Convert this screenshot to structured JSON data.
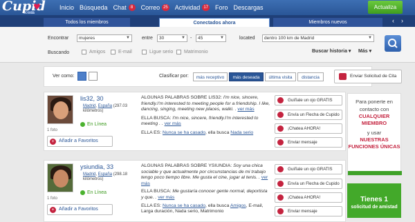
{
  "header": {
    "logo": "Cupid",
    "logo_domain": ".com",
    "nav": [
      {
        "label": "Inicio",
        "badge": ""
      },
      {
        "label": "Búsqueda",
        "badge": ""
      },
      {
        "label": "Chat",
        "badge": "8"
      },
      {
        "label": "Correo",
        "badge": "25"
      },
      {
        "label": "Actividad",
        "badge": "17"
      },
      {
        "label": "Foro",
        "badge": ""
      },
      {
        "label": "Descargas",
        "badge": ""
      }
    ],
    "action_button": "Actualiza"
  },
  "tabs": {
    "items": [
      "Todos los miembros",
      "Conectados ahora",
      "Miembros nuevos"
    ],
    "active": 1
  },
  "filters": {
    "encontrar_label": "Encontrar",
    "encontrar_value": "mujeres",
    "entre_label": "entre",
    "age_from": "30",
    "age_to": "45",
    "located_label": "located",
    "located_value": "dentro 100 km de Madrid",
    "buscando_label": "Buscando",
    "options": [
      "Amigos",
      "E-mail",
      "Ligue serio",
      "Matrimonio"
    ],
    "history": "Buscar historia",
    "more": "Más"
  },
  "view": {
    "label": "Ver como:",
    "sort_label": "Clasificar por:",
    "sort_options": [
      "más receptivo",
      "más deseada",
      "última visita",
      "distancia"
    ],
    "sort_active": 1,
    "solicitud": "Enviar Solicitud de Cita"
  },
  "profiles": [
    {
      "name": "lis32, 30",
      "loc_city": "Madrid",
      "loc_country": "España",
      "loc_dist": "(297.03 kilómetros)",
      "status": "En Línea",
      "photos": "1 foto",
      "fav": "Añadir a Favoritos",
      "about_head": "ALGUNAS PALABRAS SOBRE LIS32:",
      "about_text": "I'm nice, sincere, friendly.I'm interested to meeting people for a friendship. I like, dancing, singing, meeting new places, walki. . ",
      "ver": "ver más",
      "busca_head": "ELLA BUSCA:",
      "busca_text": "I'm nice, sincere, friendly.I'm interested to meeting . . ",
      "es_head": "ELLA ES:",
      "es_link": "Nunca se ha casado",
      "es_busca": ", ella busca",
      "es_busca_link": "Nada serio"
    },
    {
      "name": "ysiundia, 33",
      "loc_city": "Madrid",
      "loc_country": "España",
      "loc_dist": "(298.18 kilómetros)",
      "status": "En Línea",
      "photos": "1 foto",
      "fav": "Añadir a Favoritos",
      "about_head": "ALGUNAS PALABRAS SOBRE YSIUNDIA:",
      "about_text": "Soy una chica sociable y que actualmente por circunstancias de mi trabajo tengo poco tiempo libre. Me gusta el cine, jugar al tenis. . ",
      "ver": "ver más",
      "busca_head": "ELLA BUSCA:",
      "busca_text": "Me gustaría conocer gente normal, deportista y que. . ",
      "es_head": "ELLA ES:",
      "es_link": "Nunca se ha casado",
      "es_busca": ", ella busca",
      "es_busca_link": "Amigos",
      "es_extra": ", E-mail, Larga duración, Nada serio, Matrimonio"
    }
  ],
  "actions": [
    "Guíñale un ojo GRATIS",
    "Envía un Flecha de Cupido",
    "¡Chatea AHORA!",
    "Enviar mensaje"
  ],
  "ad": {
    "line1": "Para ponerte en contacto con",
    "line2": "CUALQUIER MIEMBRO",
    "line3": "y usar",
    "line4": "NUESTRAS FUNCIONES ÚNICAS"
  },
  "green": {
    "line1": "Tienes 1",
    "line2": "solicitud de amistad"
  }
}
